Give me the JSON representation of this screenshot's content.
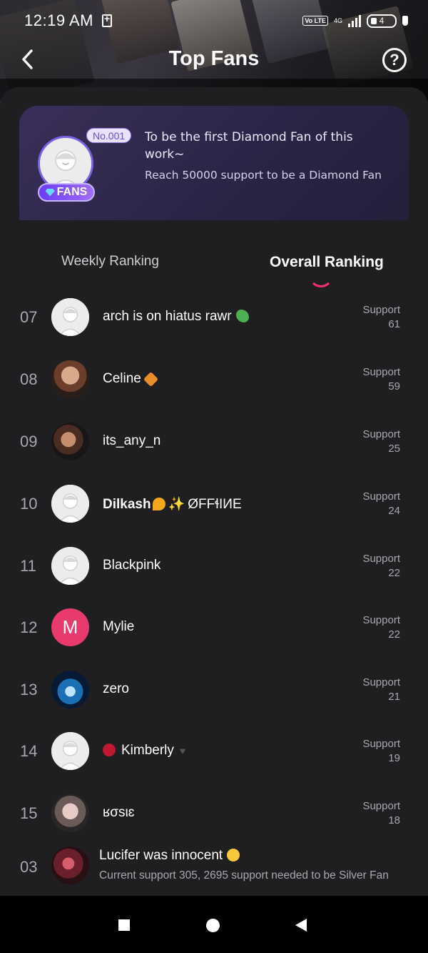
{
  "status_bar": {
    "time": "12:19 AM",
    "network": "4G",
    "volte": "Vo LTE",
    "battery": "4"
  },
  "header": {
    "title": "Top Fans"
  },
  "banner": {
    "number_tag": "No.001",
    "badge_label": "FANS",
    "line1": "To be the first Diamond Fan of this work~",
    "line2": "Reach 50000 support to be a Diamond Fan"
  },
  "tabs": [
    {
      "label": "Weekly Ranking",
      "active": false
    },
    {
      "label": "Overall Ranking",
      "active": true
    }
  ],
  "support_label": "Support",
  "ranking": [
    {
      "rank": "07",
      "name": "arch is on hiatus rawr",
      "support": "61",
      "avatar": "default",
      "emoji": "dinosaur"
    },
    {
      "rank": "08",
      "name": "Celine",
      "support": "59",
      "avatar": "photo-1",
      "emoji": "maple-leaf"
    },
    {
      "rank": "09",
      "name": "its_any_n",
      "support": "25",
      "avatar": "photo-2",
      "emoji": ""
    },
    {
      "rank": "10",
      "name": "Dilkash",
      "name_suffix": "ØFFɬIИE",
      "support": "24",
      "avatar": "default",
      "emoji": "sparkles"
    },
    {
      "rank": "11",
      "name": "Blackpink",
      "support": "22",
      "avatar": "default",
      "emoji": ""
    },
    {
      "rank": "12",
      "name": "Mylie",
      "support": "22",
      "avatar": "letter",
      "avatar_letter": "M",
      "emoji": ""
    },
    {
      "rank": "13",
      "name": "zero",
      "support": "21",
      "avatar": "photo-3",
      "emoji": ""
    },
    {
      "rank": "14",
      "name": "Kimberly",
      "support": "19",
      "avatar": "default",
      "emoji": "rose"
    },
    {
      "rank": "15",
      "name": "ʁσsιɛ",
      "support": "18",
      "avatar": "photo-4",
      "emoji": ""
    }
  ],
  "my_rank": {
    "rank": "03",
    "name": "Lucifer was innocent",
    "subtitle": "Current support 305, 2695 support needed to be Silver Fan",
    "avatar": "photo-5",
    "emoji": "kissing-face"
  },
  "colors": {
    "accent": "#ff2d74",
    "banner_bg": "#2a2546",
    "badge": "#7c4df5",
    "letter_avatar": "#e83a6c"
  }
}
